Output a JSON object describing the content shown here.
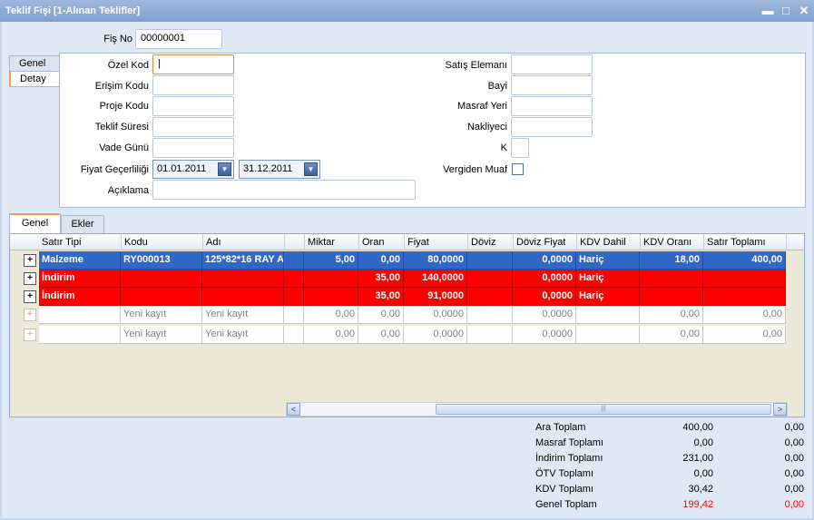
{
  "window": {
    "title": "Teklif Fişi  [1-Alınan Teklifler]",
    "controls": {
      "minimize": "▬",
      "maximize": "□",
      "close": "✕"
    }
  },
  "header": {
    "fis_no_label": "Fiş No",
    "fis_no_value": "00000001"
  },
  "side_tabs": [
    {
      "label": "Genel"
    },
    {
      "label": "Detay"
    }
  ],
  "form_left": {
    "ozel_kod": {
      "label": "Özel Kod",
      "value": "|"
    },
    "erisim_kodu": {
      "label": "Erişim Kodu",
      "value": ""
    },
    "proje_kodu": {
      "label": "Proje Kodu",
      "value": ""
    },
    "teklif_suresi": {
      "label": "Teklif Süresi",
      "value": ""
    },
    "vade_gunu": {
      "label": "Vade Günü",
      "value": ""
    },
    "fiyat_gecerliligi": {
      "label": "Fiyat Geçerliliği",
      "start": "01.01.2011",
      "end": "31.12.2011"
    },
    "aciklama": {
      "label": "Açıklama",
      "value": ""
    }
  },
  "form_right": {
    "satis_elemani": {
      "label": "Satış Elemanı",
      "value": ""
    },
    "bayi": {
      "label": "Bayi",
      "value": ""
    },
    "masraf_yeri": {
      "label": "Masraf Yeri",
      "value": ""
    },
    "nakliyeci": {
      "label": "Nakliyeci",
      "value": ""
    },
    "k": {
      "label": "K",
      "value": ""
    },
    "vergiden_muaf": {
      "label": "Vergiden Muaf",
      "checked": false
    }
  },
  "bottom_tabs": [
    {
      "label": "Genel"
    },
    {
      "label": "Ekler"
    }
  ],
  "grid": {
    "columns": [
      "Satır Tipi",
      "Kodu",
      "Adı",
      "Miktar",
      "Oran",
      "Fiyat",
      "Döviz",
      "Döviz Fiyat",
      "KDV Dahil",
      "KDV Oranı",
      "Satır Toplamı"
    ],
    "rows": [
      {
        "style": "blue",
        "cells": [
          "Malzeme",
          "RY000013",
          "125*82*16 RAY A",
          "5,00",
          "0,00",
          "80,0000",
          "",
          "0,0000",
          "Hariç",
          "18,00",
          "400,00"
        ]
      },
      {
        "style": "red",
        "cells": [
          "İndirim",
          "",
          "",
          "",
          "35,00",
          "140,0000",
          "",
          "0,0000",
          "Hariç",
          "",
          ""
        ]
      },
      {
        "style": "red",
        "cells": [
          "İndirim",
          "",
          "",
          "",
          "35,00",
          "91,0000",
          "",
          "0,0000",
          "Hariç",
          "",
          ""
        ]
      },
      {
        "style": "white",
        "cells": [
          "",
          "Yeni kayıt",
          "Yeni kayıt",
          "0,00",
          "0,00",
          "0,0000",
          "",
          "0,0000",
          "",
          "0,00",
          "0,00"
        ]
      },
      {
        "style": "white",
        "cells": [
          "",
          "Yeni kayıt",
          "Yeni kayıt",
          "0,00",
          "0,00",
          "0,0000",
          "",
          "0,0000",
          "",
          "0,00",
          "0,00"
        ]
      }
    ],
    "scroll": {
      "left": "<",
      "right": ">",
      "grip": "|||"
    }
  },
  "totals": [
    {
      "label": "Ara Toplam",
      "value1": "400,00",
      "value2": "0,00",
      "highlight": false
    },
    {
      "label": "Masraf Toplamı",
      "value1": "0,00",
      "value2": "0,00",
      "highlight": false
    },
    {
      "label": "İndirim Toplamı",
      "value1": "231,00",
      "value2": "0,00",
      "highlight": false
    },
    {
      "label": "ÖTV Toplamı",
      "value1": "0,00",
      "value2": "0,00",
      "highlight": false
    },
    {
      "label": "KDV Toplamı",
      "value1": "30,42",
      "value2": "0,00",
      "highlight": false
    },
    {
      "label": "Genel Toplam",
      "value1": "199,42",
      "value2": "0,00",
      "highlight": true
    }
  ],
  "colors": {
    "selected_row": "#3167c9",
    "discount_row": "#ff0000",
    "accent_tab": "#f0a050",
    "total_highlight": "#ff0000"
  }
}
